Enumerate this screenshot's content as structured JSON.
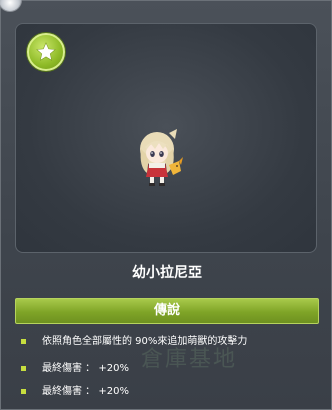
{
  "pet": {
    "name": "幼小拉尼亞",
    "rank": "傳說",
    "rank_color": "#8fb42e",
    "badge_icon": "star-icon"
  },
  "options": [
    {
      "text": "依照角色全部屬性的 90%來追加萌獸的攻擊力"
    },
    {
      "text": "最終傷害 ： +20%"
    },
    {
      "text": "最終傷害 ： +20%"
    }
  ],
  "background": {
    "ghost_text": "倉庫基地"
  }
}
